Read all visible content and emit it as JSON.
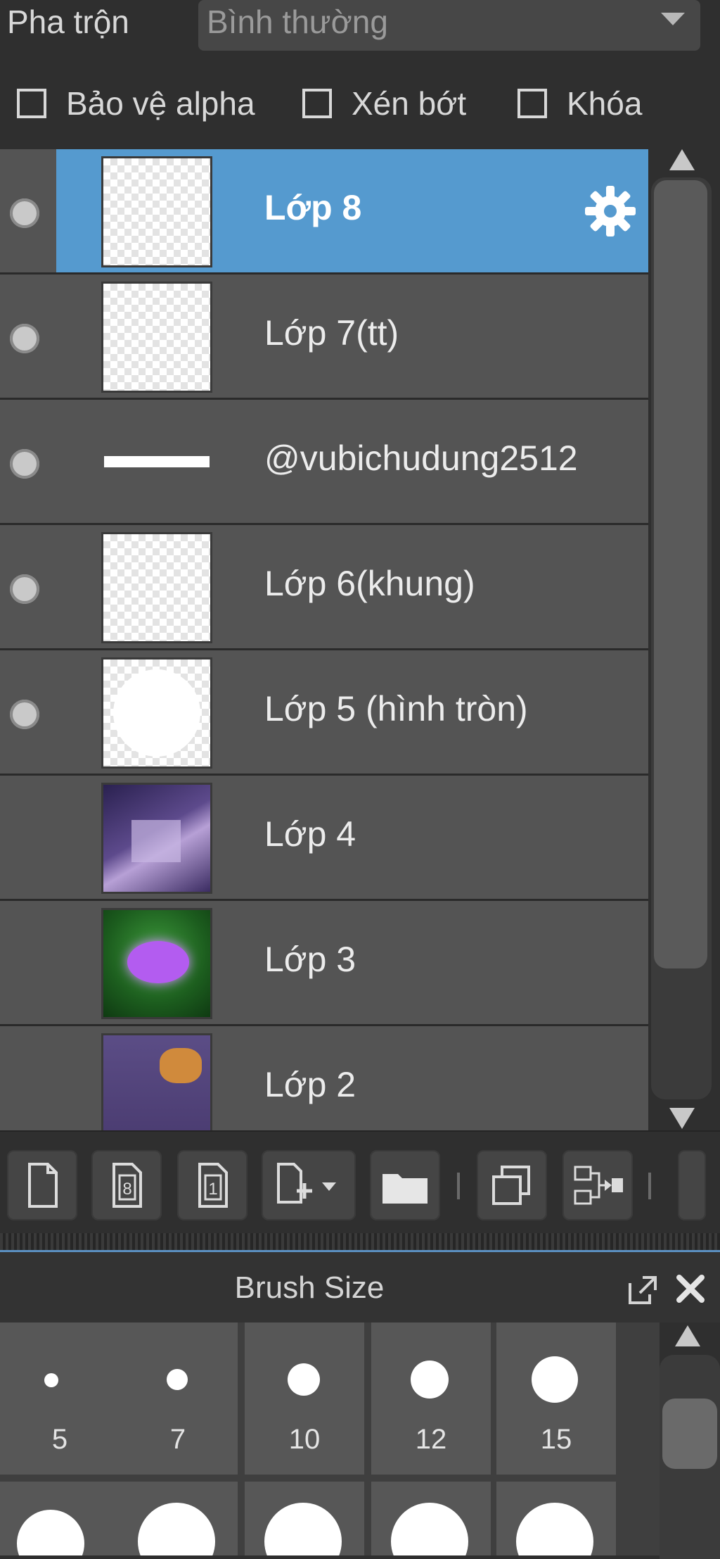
{
  "blend": {
    "label": "Pha trộn",
    "value": "Bình thường"
  },
  "options": [
    {
      "label": "Bảo vệ alpha",
      "checked": false
    },
    {
      "label": "Xén bớt",
      "checked": false
    },
    {
      "label": "Khóa",
      "checked": false
    }
  ],
  "layers": [
    {
      "name": "Lớp 8",
      "selected": true,
      "visible": true,
      "thumb": "transparent"
    },
    {
      "name": "Lớp 7(tt)",
      "selected": false,
      "visible": true,
      "thumb": "transparent"
    },
    {
      "name": "@vubichudung2512",
      "selected": false,
      "visible": true,
      "thumb": "white-line"
    },
    {
      "name": "Lớp 6(khung)",
      "selected": false,
      "visible": true,
      "thumb": "transparent"
    },
    {
      "name": "Lớp 5 (hình tròn)",
      "selected": false,
      "visible": true,
      "thumb": "white-circle"
    },
    {
      "name": "Lớp 4",
      "selected": false,
      "visible": false,
      "thumb": "purple-house-image"
    },
    {
      "name": "Lớp 3",
      "selected": false,
      "visible": false,
      "thumb": "purple-flower-image"
    },
    {
      "name": "Lớp 2",
      "selected": false,
      "visible": false,
      "thumb": "orange-flowers-image"
    }
  ],
  "toolbar": {
    "buttons": [
      "new-layer-icon",
      "new-8bit-layer-icon",
      "new-1bit-layer-icon",
      "add-layer-dropdown-icon",
      "folder-icon",
      "duplicate-layer-icon",
      "merge-layer-icon"
    ]
  },
  "brush_panel": {
    "title": "Brush Size",
    "sizes": [
      "5",
      "7",
      "10",
      "12",
      "15"
    ]
  },
  "colors": {
    "selected": "#559acf",
    "panel": "#545454",
    "background": "#2f2f2f"
  }
}
